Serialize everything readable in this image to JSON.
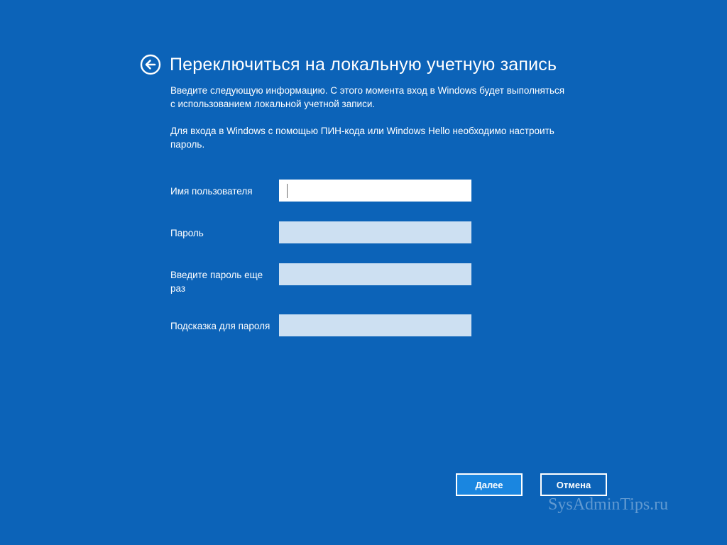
{
  "header": {
    "back_icon": "arrow-left-circle-icon",
    "title": "Переключиться на локальную учетную запись"
  },
  "description": {
    "paragraph1": "Введите следующую информацию. С этого момента вход в Windows будет выполняться с использованием локальной учетной записи.",
    "paragraph2": "Для входа в Windows с помощью ПИН-кода или Windows Hello необходимо настроить пароль."
  },
  "form": {
    "username": {
      "label": "Имя пользователя",
      "value": ""
    },
    "password": {
      "label": "Пароль",
      "value": ""
    },
    "password_confirm": {
      "label": "Введите пароль еще раз",
      "value": ""
    },
    "password_hint": {
      "label": "Подсказка для пароля",
      "value": ""
    }
  },
  "buttons": {
    "next_label": "Далее",
    "cancel_label": "Отмена"
  },
  "watermark": "SysAdminTips.ru",
  "colors": {
    "background": "#0c63b8",
    "primary_button": "#1a86e0",
    "inactive_field": "#cde0f2",
    "active_field": "#ffffff"
  }
}
